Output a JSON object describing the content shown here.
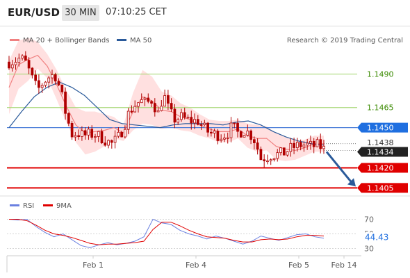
{
  "header": {
    "symbol": "EUR/USD",
    "timeframe": "30 MIN",
    "time": "07:10:25 CET"
  },
  "legend": {
    "ma20_bollinger": "MA 20 + Bollinger Bands",
    "ma50": "MA 50",
    "credit": "Research © 2019 Trading Central",
    "rsi": "RSI",
    "ma9": "9MA"
  },
  "colors": {
    "candle": "#b00000",
    "ma20": "#f08080",
    "bands_fill": "#ffd6d6",
    "ma50": "#2a5a9a",
    "resistance_line": "#a8d878",
    "resistance_text": "#3a8a00",
    "pivot_line": "#4a7dd8",
    "pivot_label": "#1f6fe0",
    "support_line": "#e00000",
    "support_label": "#e00000",
    "last_label": "#222222",
    "arrow": "#2a5a9a",
    "rsi_line": "#6a80e0",
    "ma9_line": "#e00000"
  },
  "chart_data": {
    "type": "candlestick",
    "instrument": "EUR/USD",
    "interval": "30 MIN",
    "ylim": [
      1.14,
      1.151
    ],
    "x_labels": [
      "Feb 1",
      "Feb 4",
      "Feb 5",
      "Feb 14"
    ],
    "levels": [
      {
        "label": "1.1490",
        "value": 1.149,
        "kind": "resistance"
      },
      {
        "label": "1.1465",
        "value": 1.1465,
        "kind": "resistance"
      },
      {
        "label": "1.1450",
        "value": 1.145,
        "kind": "pivot"
      },
      {
        "label": "1.1420",
        "value": 1.142,
        "kind": "support"
      },
      {
        "label": "1.1405",
        "value": 1.1405,
        "kind": "support"
      }
    ],
    "marker_labels": [
      "1.1438",
      "1.1434"
    ],
    "series": [
      {
        "name": "MA 20 + Bollinger Bands",
        "values": [
          1.148,
          1.1497,
          1.1501,
          1.1504,
          1.1496,
          1.1482,
          1.1466,
          1.1452,
          1.1446,
          1.1447,
          1.1448,
          1.145,
          1.1446,
          1.1462,
          1.1473,
          1.147,
          1.1463,
          1.1462,
          1.1458,
          1.1456,
          1.1452,
          1.1449,
          1.1447,
          1.1447,
          1.1449,
          1.1444,
          1.1442,
          1.1442,
          1.1436,
          1.1434,
          1.1433,
          1.1435,
          1.1438,
          1.1438
        ]
      },
      {
        "name": "MA 50",
        "values": [
          1.145,
          1.1462,
          1.1473,
          1.148,
          1.1484,
          1.148,
          1.1474,
          1.1465,
          1.1456,
          1.1453,
          1.1452,
          1.1451,
          1.145,
          1.1452,
          1.1453,
          1.1453,
          1.1453,
          1.1452,
          1.1454,
          1.1455,
          1.1452,
          1.1447,
          1.1443,
          1.144,
          1.1438,
          1.1437
        ]
      },
      {
        "name": "RSI",
        "values": [
          70,
          69,
          70,
          60,
          52,
          46,
          50,
          42,
          34,
          31,
          35,
          38,
          35,
          37,
          40,
          46,
          70,
          65,
          63,
          55,
          50,
          47,
          43,
          47,
          44,
          40,
          36,
          40,
          47,
          44,
          41,
          45,
          49,
          50,
          46,
          44
        ]
      },
      {
        "name": "9MA",
        "values": [
          70,
          70,
          68,
          62,
          55,
          50,
          48,
          45,
          41,
          37,
          35,
          36,
          36,
          37,
          38,
          40,
          56,
          66,
          66,
          61,
          55,
          50,
          46,
          45,
          44,
          41,
          39,
          39,
          42,
          43,
          42,
          43,
          46,
          48,
          48,
          47
        ]
      }
    ],
    "rsi": {
      "ticks": [
        "70",
        "50",
        "30"
      ],
      "last": "44.43",
      "ylim": [
        20,
        80
      ]
    }
  }
}
